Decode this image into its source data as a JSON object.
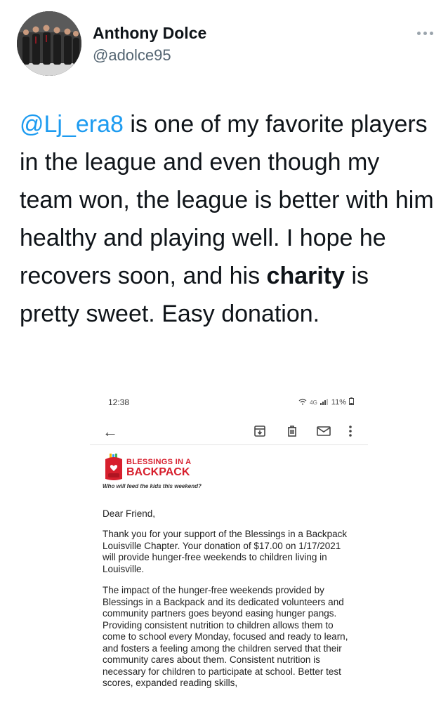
{
  "tweet": {
    "author_name": "Anthony Dolce",
    "author_handle": "@adolce95",
    "text_mention": "@Lj_era8",
    "text_part1": " is one of my favorite players in the league and even though my team won, the league is better with him healthy and playing well. I hope he recovers soon, and his ",
    "text_bold": "charity",
    "text_part2": " is pretty sweet. Easy donation.",
    "more_icon": "more-horizontal-icon"
  },
  "screenshot": {
    "status_time": "12:38",
    "status_network": "4G",
    "status_battery": "11%",
    "toolbar_icons": [
      "back-arrow-icon",
      "archive-icon",
      "trash-icon",
      "mail-icon",
      "more-vertical-icon"
    ],
    "logo_line1": "BLESSINGS IN A",
    "logo_line2": "BACKPACK",
    "logo_tagline": "Who will feed the kids this weekend?",
    "greeting": "Dear Friend,",
    "paragraph1": "Thank you for your support of the Blessings in a Backpack Louisville Chapter. Your donation of $17.00 on 1/17/2021 will provide hunger-free weekends to children living in Louisville.",
    "paragraph2": "The impact of the hunger-free weekends provided by Blessings in a Backpack and its dedicated volunteers and community partners goes beyond easing hunger pangs. Providing consistent nutrition to children allows them to come to school every Monday, focused and ready to learn, and fosters a feeling among the children served that their community cares about them. Consistent nutrition is necessary for children to participate at school. Better test scores, expanded reading skills,"
  },
  "colors": {
    "mention": "#1d9bf0",
    "brand_red": "#d71f2d",
    "handle_gray": "#536471"
  }
}
